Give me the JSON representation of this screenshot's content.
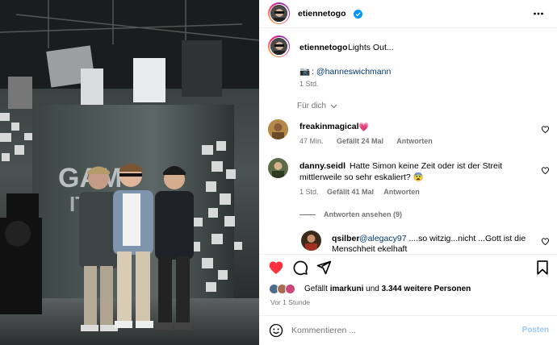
{
  "post": {
    "author": "etiennetogo",
    "caption": "Lights Out...",
    "credit_icon": "camera-emoji",
    "credit_icon_glyph": "📷",
    "credit_colon": ":",
    "credit_mention": "@hanneswichmann",
    "caption_time": "1 Std.",
    "sort_label": "Für dich"
  },
  "photo": {
    "wall_text_1": "GAM",
    "wall_text_2": "IT"
  },
  "comments": [
    {
      "user": "freakinmagical",
      "text": "💗",
      "time": "47 Min.",
      "likes": "Gefällt 24 Mal",
      "reply": "Antworten"
    },
    {
      "user": "danny.seidl",
      "text": "Hatte Simon keine Zeit oder ist der Streit",
      "text_line2": "mittlerweile so sehr eskaliert? 😨",
      "time": "1 Std.",
      "likes": "Gefällt 41 Mal",
      "reply": "Antworten",
      "view_replies": "Antworten ansehen (9)"
    },
    {
      "user": "qsilber",
      "mention": "@alegacy97",
      "text": " ....so witzig...nicht ...Gott ist die",
      "text_line2": "Menschheit ekelhaft"
    }
  ],
  "actions": {
    "liked_prefix": "Gefällt ",
    "liked_user": "imarkuni",
    "liked_mid": " und ",
    "liked_count": "3.344 weitere Personen",
    "date": "Vor 1 Stunde"
  },
  "composer": {
    "placeholder": "Kommentieren ...",
    "post_label": "Posten"
  },
  "colors": {
    "like_red": "#ff3040",
    "link_blue": "#00376b",
    "verified_blue": "#0095f6"
  }
}
